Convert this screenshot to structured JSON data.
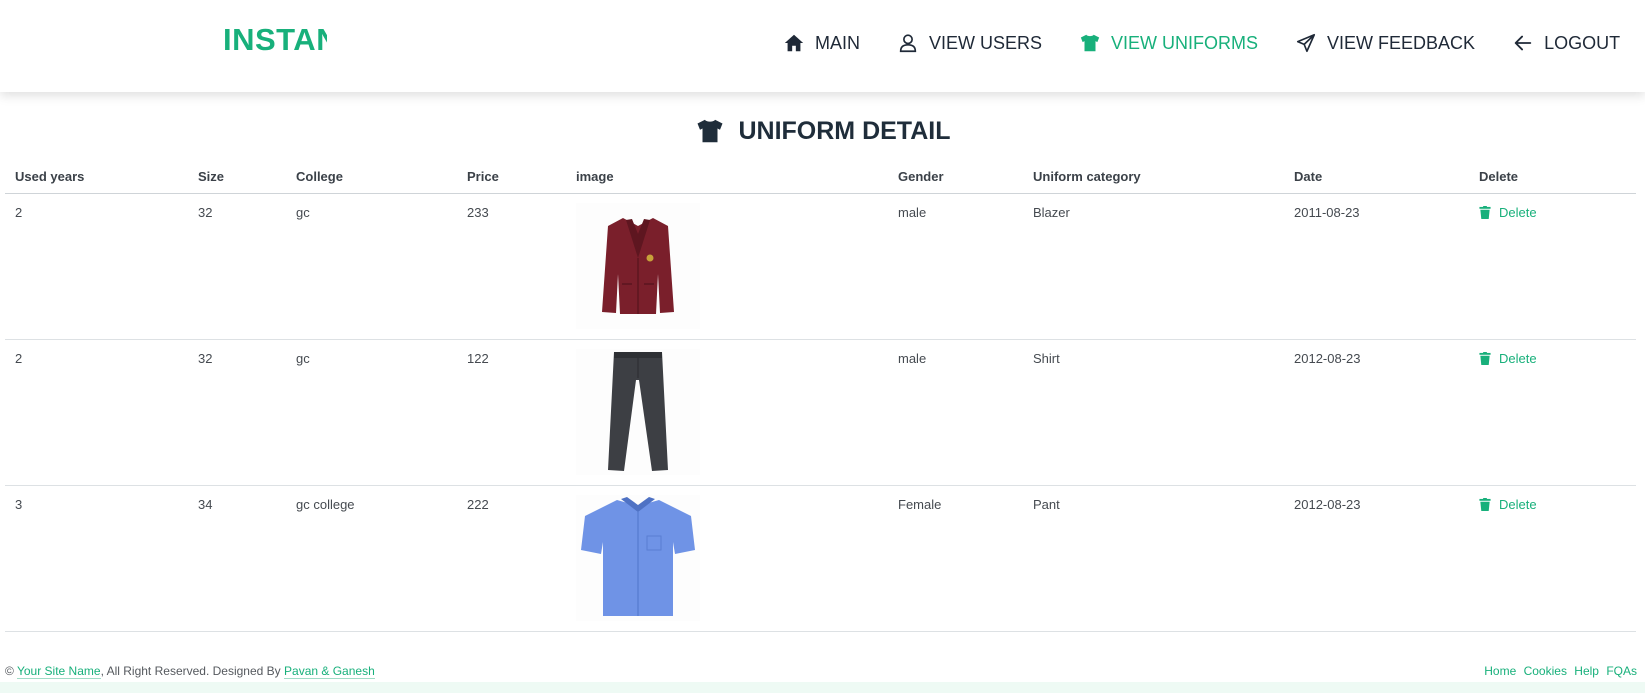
{
  "header": {
    "logo": "INSTANT",
    "nav": [
      {
        "label": "MAIN",
        "icon": "home-icon"
      },
      {
        "label": "VIEW USERS",
        "icon": "user-icon"
      },
      {
        "label": "VIEW UNIFORMS",
        "icon": "tshirt-icon",
        "active": true
      },
      {
        "label": "VIEW FEEDBACK",
        "icon": "paper-plane-icon"
      },
      {
        "label": "LOGOUT",
        "icon": "arrow-left-icon"
      }
    ]
  },
  "page": {
    "title": "UNIFORM DETAIL",
    "title_icon": "tshirt-icon"
  },
  "table": {
    "headers": [
      "Used years",
      "Size",
      "College",
      "Price",
      "image",
      "Gender",
      "Uniform category",
      "Date",
      "Delete"
    ],
    "rows": [
      {
        "used_years": "2",
        "size": "32",
        "college": "gc",
        "price": "233",
        "image": "maroon-blazer",
        "gender": "male",
        "category": "Blazer",
        "date": "2011-08-23",
        "delete": "Delete"
      },
      {
        "used_years": "2",
        "size": "32",
        "college": "gc",
        "price": "122",
        "image": "grey-trousers",
        "gender": "male",
        "category": "Shirt",
        "date": "2012-08-23",
        "delete": "Delete"
      },
      {
        "used_years": "3",
        "size": "34",
        "college": "gc college",
        "price": "222",
        "image": "blue-shirt",
        "gender": "Female",
        "category": "Pant",
        "date": "2012-08-23",
        "delete": "Delete"
      }
    ]
  },
  "footer": {
    "copyright": "©",
    "site_name": "Your Site Name",
    "rights": ", All Right Reserved. Designed By",
    "designer": "Pavan & Ganesh",
    "links": [
      "Home",
      "Cookies",
      "Help",
      "FQAs"
    ]
  },
  "colors": {
    "accent": "#18b07b",
    "heading": "#1f2d3a"
  }
}
